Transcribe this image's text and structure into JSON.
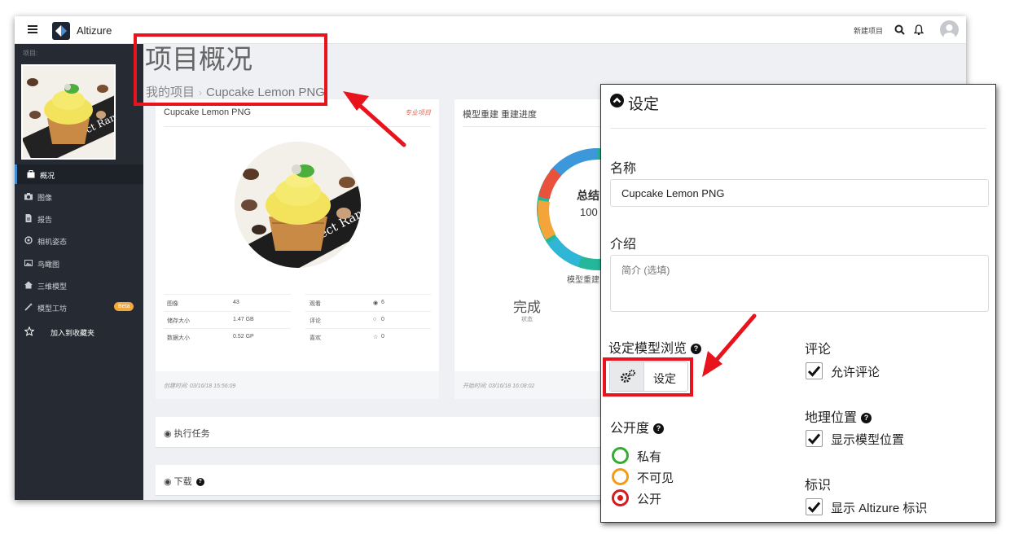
{
  "topbar": {
    "brand": "Altizure",
    "new_project": "新建项目"
  },
  "sidebar": {
    "project_label": "项目:",
    "items": [
      {
        "label": "概况",
        "icon": "briefcase-icon",
        "active": true
      },
      {
        "label": "图像",
        "icon": "camera-icon"
      },
      {
        "label": "报告",
        "icon": "document-icon"
      },
      {
        "label": "相机姿态",
        "icon": "target-icon"
      },
      {
        "label": "鸟瞰图",
        "icon": "image-icon"
      },
      {
        "label": "三维模型",
        "icon": "home-icon"
      },
      {
        "label": "模型工坊",
        "icon": "magic-wand-icon",
        "badge": "Beta"
      },
      {
        "label": "加入到收藏夹",
        "icon": "star-icon"
      }
    ]
  },
  "header": {
    "title": "项目概况",
    "breadcrumb": [
      "我的项目",
      "Cupcake Lemon PNG"
    ]
  },
  "project_card": {
    "title": "Cupcake Lemon PNG",
    "tag": "专业项目",
    "stats": [
      {
        "label": "图像",
        "value": "43"
      },
      {
        "label": "储存大小",
        "value": "1.47 GB"
      },
      {
        "label": "数据大小",
        "value": "0.52 GP"
      },
      {
        "label": "观看",
        "value": "6",
        "icon": "eye-icon"
      },
      {
        "label": "评论",
        "value": "0",
        "icon": "comment-icon"
      },
      {
        "label": "喜欢",
        "value": "0",
        "icon": "star-icon"
      }
    ],
    "footer": "创建时间: 03/16/18 15:56:09"
  },
  "recon_card": {
    "title": "模型重建 重建进度",
    "summary_label": "总结",
    "summary_value": "100",
    "donut_caption": "模型重建",
    "done_value": "完成",
    "done_label": "状态",
    "footer": "开始时间: 03/16/18 16:08:02",
    "colors": [
      "#3d98db",
      "#e9513d",
      "#f3a53a",
      "#2fb5d6",
      "#25b79a"
    ]
  },
  "panels": {
    "tasks": "执行任务",
    "download": "下载"
  },
  "settings": {
    "title": "设定",
    "name_label": "名称",
    "name_value": "Cupcake Lemon PNG",
    "intro_label": "介绍",
    "intro_placeholder": "简介 (选填)",
    "viewer_label": "设定模型浏览",
    "viewer_button": "设定",
    "privacy_label": "公开度",
    "privacy_options": [
      {
        "label": "私有",
        "color": "#2fae2f"
      },
      {
        "label": "不可见",
        "color": "#f39c12"
      },
      {
        "label": "公开",
        "color": "#d9191b",
        "selected": true
      }
    ],
    "comment_label": "评论",
    "comment_option": "允许评论",
    "geo_label": "地理位置",
    "geo_option": "显示模型位置",
    "mark_label": "标识",
    "mark_option": "显示 Altizure 标识"
  },
  "highlight_color": "#e8131c"
}
